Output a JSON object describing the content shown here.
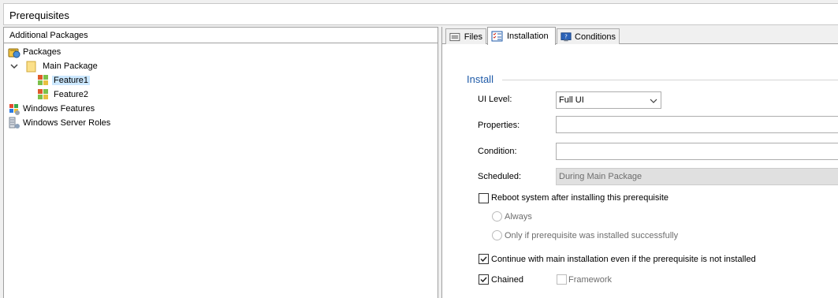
{
  "window": {
    "title": "Prerequisites"
  },
  "left_panel": {
    "header": "Additional Packages",
    "tree": {
      "packages": {
        "label": "Packages",
        "icon": "package-icon"
      },
      "main_package": {
        "label": "Main Package",
        "icon": "folder-icon",
        "expanded": true
      },
      "feature1": {
        "label": "Feature1",
        "icon": "feature-icon",
        "selected": true
      },
      "feature2": {
        "label": "Feature2",
        "icon": "feature-icon"
      },
      "windows_features": {
        "label": "Windows Features",
        "icon": "windows-features-icon"
      },
      "windows_server_roles": {
        "label": "Windows Server Roles",
        "icon": "server-roles-icon"
      }
    }
  },
  "tabs": [
    {
      "label": "Files",
      "icon": "files-icon"
    },
    {
      "label": "Installation",
      "icon": "checklist-icon",
      "active": true
    },
    {
      "label": "Conditions",
      "icon": "conditions-icon"
    }
  ],
  "install": {
    "group_title": "Install",
    "ui_level_label": "UI Level:",
    "ui_level_value": "Full UI",
    "properties_label": "Properties:",
    "properties_value": "",
    "condition_label": "Condition:",
    "condition_value": "",
    "scheduled_label": "Scheduled:",
    "scheduled_value": "During Main Package",
    "reboot_label": "Reboot system after installing this prerequisite",
    "reboot_checked": false,
    "always_label": "Always",
    "only_if_label": "Only if prerequisite was installed successfully",
    "continue_label": "Continue with main installation even if the prerequisite is not installed",
    "continue_checked": true,
    "chained_label": "Chained",
    "chained_checked": true,
    "framework_label": "Framework",
    "framework_checked": false
  },
  "colors": {
    "selection": "#cce8ff",
    "accent_blue": "#1e5aa8",
    "disabled_field": "#e0e0e0"
  }
}
